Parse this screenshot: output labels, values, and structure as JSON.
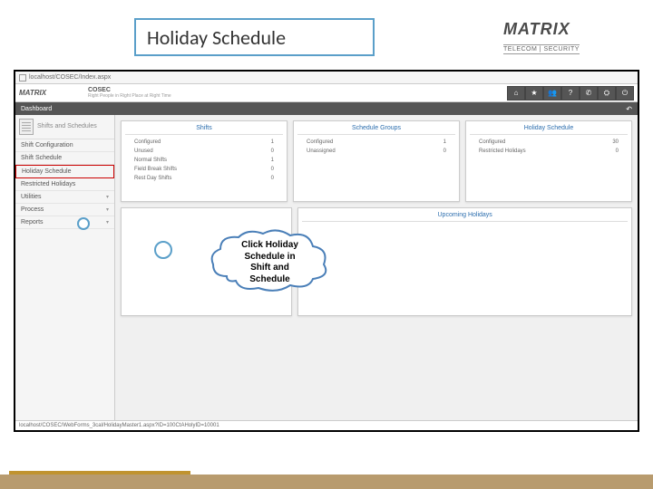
{
  "slide": {
    "title": "Holiday Schedule"
  },
  "brand": {
    "name": "MATRIX",
    "tagline": "TELECOM | SECURITY"
  },
  "url": "localhost/COSEC/Index.aspx",
  "app": {
    "product": "COSEC",
    "slogan": "Right People in Right Place at Right Time",
    "dashboard_label": "Dashboard",
    "toolbar_icons": [
      "home-icon",
      "star-icon",
      "users-icon",
      "help-icon",
      "phone-icon",
      "sliders-icon",
      "power-icon"
    ],
    "toolbar_glyphs": [
      "⌂",
      "★",
      "👥",
      "?",
      "✆",
      "⛭",
      "⏻"
    ]
  },
  "sidebar": {
    "section_title": "Shifts and Schedules",
    "items": [
      {
        "label": "Shift Configuration"
      },
      {
        "label": "Shift Schedule"
      },
      {
        "label": "Holiday Schedule",
        "highlighted": true
      },
      {
        "label": "Restricted Holidays"
      },
      {
        "label": "Utilities",
        "expandable": true
      },
      {
        "label": "Process",
        "expandable": true
      },
      {
        "label": "Reports",
        "expandable": true
      }
    ]
  },
  "cards": {
    "shifts": {
      "title": "Shifts",
      "rows": [
        {
          "label": "Configured",
          "value": "1"
        },
        {
          "label": "Unused",
          "value": "0"
        },
        {
          "label": "Normal Shifts",
          "value": "1"
        },
        {
          "label": "Field Break Shifts",
          "value": "0"
        },
        {
          "label": "Rest Day Shifts",
          "value": "0"
        }
      ]
    },
    "schedule_groups": {
      "title": "Schedule Groups",
      "rows": [
        {
          "label": "Configured",
          "value": "1"
        },
        {
          "label": "Unassigned",
          "value": "0"
        }
      ]
    },
    "holiday_schedule": {
      "title": "Holiday Schedule",
      "rows": [
        {
          "label": "Configured",
          "value": "30"
        },
        {
          "label": "Restricted Holidays",
          "value": "0"
        }
      ]
    },
    "upcoming": {
      "title": "Upcoming Holidays"
    }
  },
  "callout": {
    "line1": "Click Holiday",
    "line2": "Schedule in",
    "line3": "Shift and",
    "line4": "Schedule"
  },
  "status": "localhost/COSEC/WebForms_3cal/HolidayMaster1.aspx?ID=100CtAHolyID=10001"
}
